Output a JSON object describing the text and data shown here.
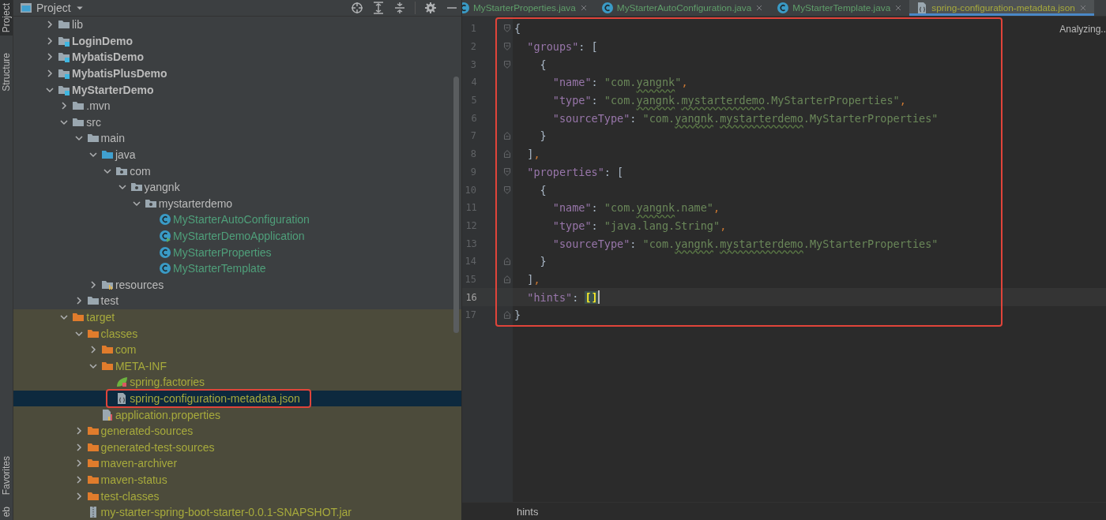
{
  "tool_stripe": {
    "top": [
      {
        "label": "Project",
        "selected": true
      },
      {
        "label": "Structure",
        "selected": false
      }
    ],
    "bottom": [
      {
        "label": "Favorites",
        "selected": false
      },
      {
        "label": "eb",
        "selected": false
      }
    ]
  },
  "project_panel": {
    "title": "Project",
    "tree": [
      {
        "label": "lib",
        "kind": "folder",
        "bold": false,
        "expanded": false,
        "selected": false,
        "color": "#bbbbbb"
      },
      {
        "label": "LoginDemo",
        "kind": "module",
        "bold": true,
        "expanded": false,
        "selected": false,
        "color": "#bbbbbb"
      },
      {
        "label": "MybatisDemo",
        "kind": "module",
        "bold": true,
        "expanded": false,
        "selected": false,
        "color": "#bbbbbb"
      },
      {
        "label": "MybatisPlusDemo",
        "kind": "module",
        "bold": true,
        "expanded": false,
        "selected": false,
        "color": "#bbbbbb"
      },
      {
        "label": "MyStarterDemo",
        "kind": "module",
        "bold": true,
        "expanded": true,
        "selected": false,
        "color": "#bbbbbb",
        "children": [
          {
            "label": ".mvn",
            "kind": "folder",
            "expanded": false,
            "selected": false,
            "color": "#bbbbbb"
          },
          {
            "label": "src",
            "kind": "folder",
            "expanded": true,
            "selected": false,
            "color": "#bbbbbb",
            "children": [
              {
                "label": "main",
                "kind": "folder",
                "expanded": true,
                "selected": false,
                "color": "#bbbbbb",
                "children": [
                  {
                    "label": "java",
                    "kind": "source-folder",
                    "expanded": true,
                    "selected": false,
                    "color": "#bbbbbb",
                    "children": [
                      {
                        "label": "com",
                        "kind": "package",
                        "expanded": true,
                        "selected": false,
                        "color": "#bbbbbb",
                        "children": [
                          {
                            "label": "yangnk",
                            "kind": "package",
                            "expanded": true,
                            "selected": false,
                            "color": "#bbbbbb",
                            "children": [
                              {
                                "label": "mystarterdemo",
                                "kind": "package",
                                "expanded": true,
                                "selected": false,
                                "color": "#bbbbbb",
                                "children": [
                                  {
                                    "label": "MyStarterAutoConfiguration",
                                    "kind": "class",
                                    "selected": false,
                                    "color": "#4f9f7a"
                                  },
                                  {
                                    "label": "MyStarterDemoApplication",
                                    "kind": "app-class",
                                    "selected": false,
                                    "color": "#4f9f7a"
                                  },
                                  {
                                    "label": "MyStarterProperties",
                                    "kind": "class",
                                    "selected": false,
                                    "color": "#4f9f7a"
                                  },
                                  {
                                    "label": "MyStarterTemplate",
                                    "kind": "class",
                                    "selected": false,
                                    "color": "#4f9f7a"
                                  }
                                ]
                              }
                            ]
                          }
                        ]
                      }
                    ]
                  },
                  {
                    "label": "resources",
                    "kind": "resources-folder",
                    "expanded": false,
                    "selected": false,
                    "color": "#bbbbbb"
                  }
                ]
              },
              {
                "label": "test",
                "kind": "folder",
                "expanded": false,
                "selected": false,
                "color": "#bbbbbb"
              }
            ]
          },
          {
            "label": "target",
            "kind": "excluded-folder",
            "excluded": true,
            "expanded": true,
            "selected": false,
            "color": "#a7aa3c",
            "children": [
              {
                "label": "classes",
                "kind": "excluded-folder",
                "expanded": true,
                "selected": false,
                "color": "#a7aa3c",
                "children": [
                  {
                    "label": "com",
                    "kind": "excluded-folder",
                    "expanded": false,
                    "selected": false,
                    "color": "#a7aa3c"
                  },
                  {
                    "label": "META-INF",
                    "kind": "excluded-folder",
                    "expanded": true,
                    "selected": false,
                    "color": "#a7aa3c",
                    "children": [
                      {
                        "label": "spring.factories",
                        "kind": "spring-file",
                        "selected": false,
                        "color": "#a7aa3c"
                      },
                      {
                        "label": "spring-configuration-metadata.json",
                        "kind": "json-file",
                        "selected": true,
                        "highlighted": true,
                        "color": "#a7aa3c"
                      }
                    ]
                  },
                  {
                    "label": "application.properties",
                    "kind": "properties-file",
                    "selected": false,
                    "color": "#a7aa3c"
                  }
                ]
              },
              {
                "label": "generated-sources",
                "kind": "excluded-folder",
                "expanded": false,
                "selected": false,
                "color": "#a7aa3c"
              },
              {
                "label": "generated-test-sources",
                "kind": "excluded-folder",
                "expanded": false,
                "selected": false,
                "color": "#a7aa3c"
              },
              {
                "label": "maven-archiver",
                "kind": "excluded-folder",
                "expanded": false,
                "selected": false,
                "color": "#a7aa3c"
              },
              {
                "label": "maven-status",
                "kind": "excluded-folder",
                "expanded": false,
                "selected": false,
                "color": "#a7aa3c"
              },
              {
                "label": "test-classes",
                "kind": "excluded-folder",
                "expanded": false,
                "selected": false,
                "color": "#a7aa3c"
              },
              {
                "label": "my-starter-spring-boot-starter-0.0.1-SNAPSHOT.jar",
                "kind": "jar-file",
                "selected": false,
                "color": "#a7aa3c"
              }
            ]
          }
        ]
      }
    ]
  },
  "editor": {
    "tabs": [
      {
        "label": "MyStarterProperties.java",
        "kind": "class",
        "selected": false,
        "color": "#5f9f6a"
      },
      {
        "label": "MyStarterAutoConfiguration.java",
        "kind": "class",
        "selected": false,
        "color": "#5f9f6a"
      },
      {
        "label": "MyStarterTemplate.java",
        "kind": "class",
        "selected": false,
        "color": "#5f9f6a"
      },
      {
        "label": "spring-configuration-metadata.json",
        "kind": "json-file",
        "selected": true,
        "color": "#a7aa3c"
      }
    ],
    "status": "Analyzing..",
    "highlighted": true,
    "lines": [
      {
        "number": "1",
        "fold_start": true,
        "fold_end": false,
        "current": false,
        "caret": false,
        "tokens": [
          {
            "kind": "open",
            "text": "{"
          }
        ]
      },
      {
        "number": "2",
        "fold_start": true,
        "fold_end": false,
        "current": false,
        "caret": false,
        "tokens": [
          {
            "kind": "key",
            "text": "\"groups\""
          },
          {
            "kind": "punct",
            "text": ": "
          },
          {
            "kind": "open",
            "text": "["
          }
        ]
      },
      {
        "number": "3",
        "fold_start": true,
        "fold_end": false,
        "current": false,
        "caret": false,
        "tokens": [
          {
            "kind": "open",
            "text": "{"
          }
        ]
      },
      {
        "number": "4",
        "fold_start": false,
        "fold_end": false,
        "current": false,
        "caret": false,
        "tokens": [
          {
            "kind": "key",
            "text": "\"name\""
          },
          {
            "kind": "punct",
            "text": ": "
          },
          {
            "kind": "string",
            "text": "\"com."
          },
          {
            "kind": "typo",
            "text": "yangnk"
          },
          {
            "kind": "string",
            "text": "\""
          },
          {
            "kind": "comma",
            "text": ","
          }
        ]
      },
      {
        "number": "5",
        "fold_start": false,
        "fold_end": false,
        "current": false,
        "caret": false,
        "tokens": [
          {
            "kind": "key",
            "text": "\"type\""
          },
          {
            "kind": "punct",
            "text": ": "
          },
          {
            "kind": "string",
            "text": "\"com."
          },
          {
            "kind": "typo",
            "text": "yangnk"
          },
          {
            "kind": "string",
            "text": "."
          },
          {
            "kind": "typo",
            "text": "mystarterdemo"
          },
          {
            "kind": "string",
            "text": ".MyStarterProperties\""
          },
          {
            "kind": "comma",
            "text": ","
          }
        ]
      },
      {
        "number": "6",
        "fold_start": false,
        "fold_end": false,
        "current": false,
        "caret": false,
        "tokens": [
          {
            "kind": "key",
            "text": "\"sourceType\""
          },
          {
            "kind": "punct",
            "text": ": "
          },
          {
            "kind": "string",
            "text": "\"com."
          },
          {
            "kind": "typo",
            "text": "yangnk"
          },
          {
            "kind": "string",
            "text": "."
          },
          {
            "kind": "typo",
            "text": "mystarterdemo"
          },
          {
            "kind": "string",
            "text": ".MyStarterProperties\""
          }
        ]
      },
      {
        "number": "7",
        "fold_start": false,
        "fold_end": true,
        "current": false,
        "caret": false,
        "tokens": [
          {
            "kind": "close",
            "text": "}"
          }
        ]
      },
      {
        "number": "8",
        "fold_start": false,
        "fold_end": true,
        "current": false,
        "caret": false,
        "tokens": [
          {
            "kind": "close",
            "text": "]"
          },
          {
            "kind": "comma",
            "text": ","
          }
        ]
      },
      {
        "number": "9",
        "fold_start": true,
        "fold_end": false,
        "current": false,
        "caret": false,
        "tokens": [
          {
            "kind": "key",
            "text": "\"properties\""
          },
          {
            "kind": "punct",
            "text": ": "
          },
          {
            "kind": "open",
            "text": "["
          }
        ]
      },
      {
        "number": "10",
        "fold_start": true,
        "fold_end": false,
        "current": false,
        "caret": false,
        "tokens": [
          {
            "kind": "open",
            "text": "{"
          }
        ]
      },
      {
        "number": "11",
        "fold_start": false,
        "fold_end": false,
        "current": false,
        "caret": false,
        "tokens": [
          {
            "kind": "key",
            "text": "\"name\""
          },
          {
            "kind": "punct",
            "text": ": "
          },
          {
            "kind": "string",
            "text": "\"com."
          },
          {
            "kind": "typo",
            "text": "yangnk"
          },
          {
            "kind": "string",
            "text": ".name\""
          },
          {
            "kind": "comma",
            "text": ","
          }
        ]
      },
      {
        "number": "12",
        "fold_start": false,
        "fold_end": false,
        "current": false,
        "caret": false,
        "tokens": [
          {
            "kind": "key",
            "text": "\"type\""
          },
          {
            "kind": "punct",
            "text": ": "
          },
          {
            "kind": "string",
            "text": "\"java.lang.String\""
          },
          {
            "kind": "comma",
            "text": ","
          }
        ]
      },
      {
        "number": "13",
        "fold_start": false,
        "fold_end": false,
        "current": false,
        "caret": false,
        "tokens": [
          {
            "kind": "key",
            "text": "\"sourceType\""
          },
          {
            "kind": "punct",
            "text": ": "
          },
          {
            "kind": "string",
            "text": "\"com."
          },
          {
            "kind": "typo",
            "text": "yangnk"
          },
          {
            "kind": "string",
            "text": "."
          },
          {
            "kind": "typo",
            "text": "mystarterdemo"
          },
          {
            "kind": "string",
            "text": ".MyStarterProperties\""
          }
        ]
      },
      {
        "number": "14",
        "fold_start": false,
        "fold_end": true,
        "current": false,
        "caret": false,
        "tokens": [
          {
            "kind": "close",
            "text": "}"
          }
        ]
      },
      {
        "number": "15",
        "fold_start": false,
        "fold_end": true,
        "current": false,
        "caret": false,
        "tokens": [
          {
            "kind": "close",
            "text": "]"
          },
          {
            "kind": "comma",
            "text": ","
          }
        ]
      },
      {
        "number": "16",
        "fold_start": false,
        "fold_end": false,
        "current": true,
        "caret": true,
        "tokens": [
          {
            "kind": "key",
            "text": "\"hints\""
          },
          {
            "kind": "punct",
            "text": ": "
          },
          {
            "kind": "match",
            "text": "[]"
          }
        ]
      },
      {
        "number": "17",
        "fold_start": false,
        "fold_end": true,
        "current": false,
        "caret": false,
        "tokens": [
          {
            "kind": "close",
            "text": "}"
          }
        ]
      }
    ],
    "breadcrumb": "hints"
  }
}
